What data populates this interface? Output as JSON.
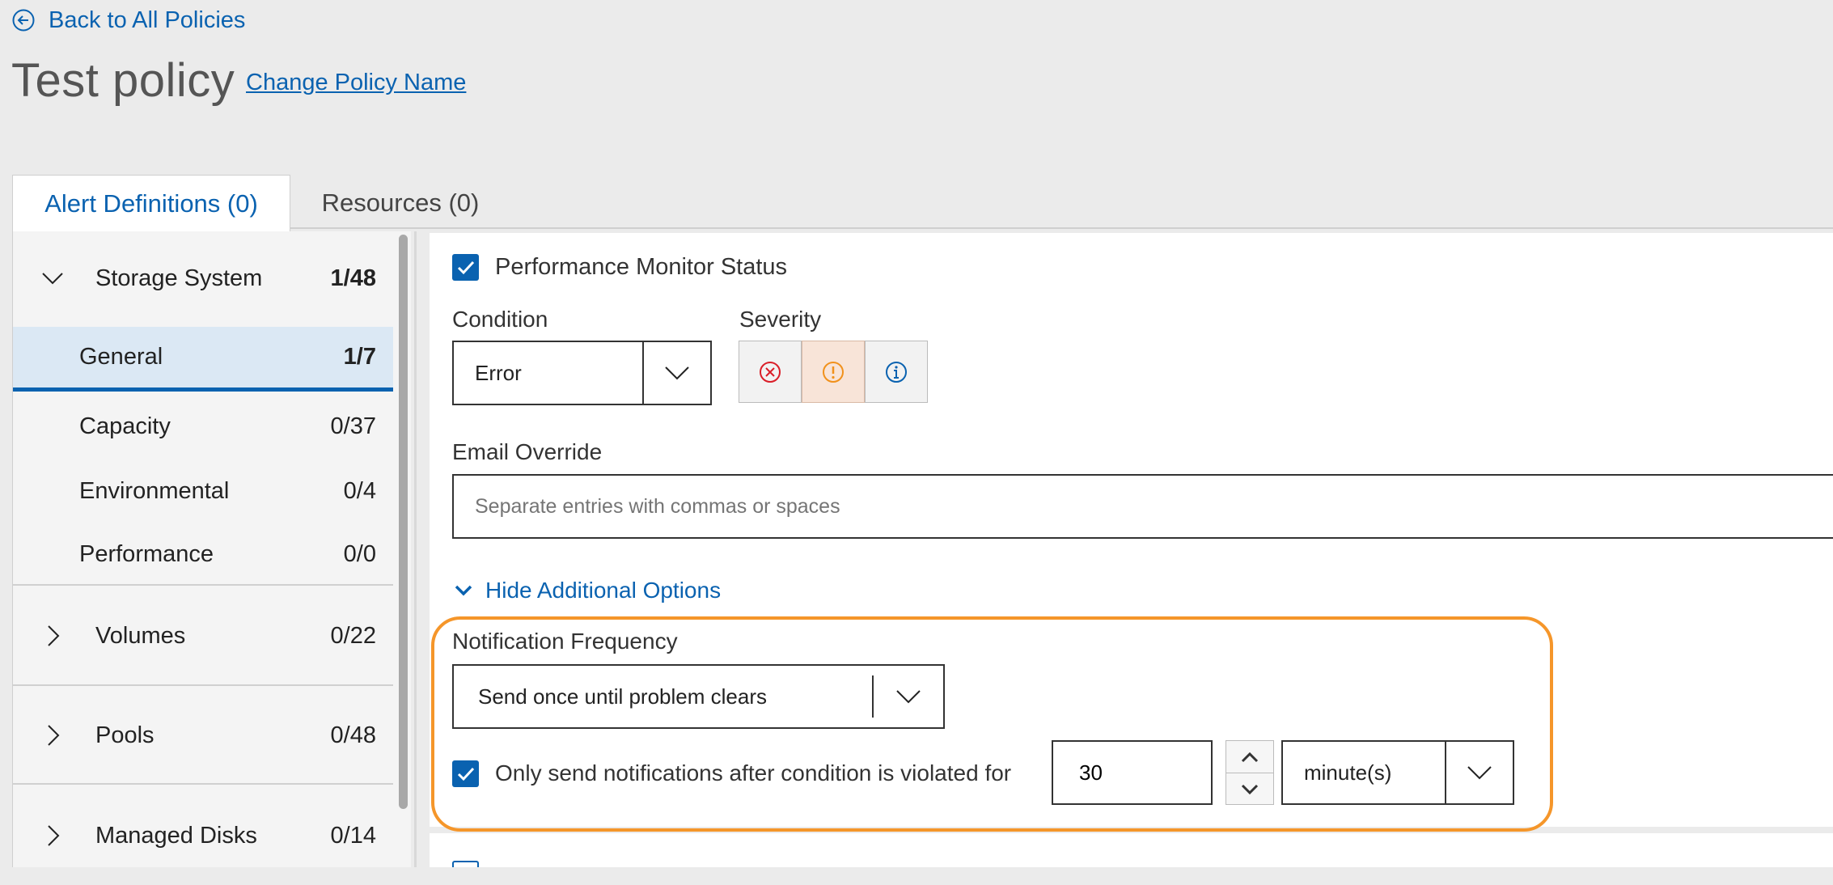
{
  "header": {
    "back_label": "Back to All Policies",
    "title": "Test policy",
    "change_name_label": "Change Policy Name"
  },
  "tabs": [
    {
      "label": "Alert Definitions (0)",
      "active": true
    },
    {
      "label": "Resources (0)",
      "active": false
    }
  ],
  "sidebar": {
    "groups": [
      {
        "label": "Storage System",
        "count": "1/48",
        "expanded": true,
        "items": [
          {
            "label": "General",
            "count": "1/7",
            "selected": true
          },
          {
            "label": "Capacity",
            "count": "0/37"
          },
          {
            "label": "Environmental",
            "count": "0/4"
          },
          {
            "label": "Performance",
            "count": "0/0"
          }
        ]
      },
      {
        "label": "Volumes",
        "count": "0/22",
        "expanded": false
      },
      {
        "label": "Pools",
        "count": "0/48",
        "expanded": false
      },
      {
        "label": "Managed Disks",
        "count": "0/14",
        "expanded": false
      }
    ]
  },
  "alert": {
    "name": "Performance Monitor Status",
    "checked": true,
    "condition_label": "Condition",
    "condition_value": "Error",
    "severity_label": "Severity",
    "severity_selected": "warning",
    "email_label": "Email Override",
    "email_placeholder": "Separate entries with commas or spaces",
    "toggle_options_label": "Hide Additional Options",
    "notification_label": "Notification Frequency",
    "notification_value": "Send once until problem clears",
    "violation_label": "Only send notifications after condition is violated for",
    "violation_checked": true,
    "violation_value": "30",
    "violation_unit": "minute(s)"
  },
  "colors": {
    "accent": "#0a62b0",
    "highlight": "#f5962a",
    "critical": "#da1e28",
    "warning": "#f1911c",
    "info": "#0a62b0"
  }
}
